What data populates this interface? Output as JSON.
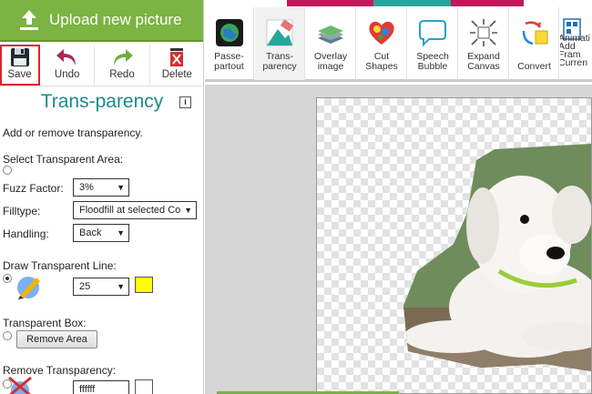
{
  "upload": {
    "label": "Upload new picture"
  },
  "toolbar": {
    "save": "Save",
    "undo": "Undo",
    "redo": "Redo",
    "delete": "Delete"
  },
  "panel": {
    "title": "Trans-parency",
    "info_icon": "i",
    "description": "Add or remove transparency.",
    "select_area_label": "Select Transparent Area:",
    "fuzz_label": "Fuzz Factor:",
    "fuzz_value": "3%",
    "filltype_label": "Filltype:",
    "filltype_value": "Floodfill at selected Co",
    "handling_label": "Handling:",
    "handling_value": "Back",
    "draw_line_label": "Draw Transparent Line:",
    "line_width_value": "25",
    "line_color": "#ffff00",
    "box_label": "Transparent Box:",
    "remove_area_button": "Remove Area",
    "remove_label": "Remove Transparency:",
    "remove_color_value": "ffffff"
  },
  "tools": [
    {
      "id": "passe-partout",
      "line1": "Passe-",
      "line2": "partout"
    },
    {
      "id": "transparency",
      "line1": "Trans-",
      "line2": "parency"
    },
    {
      "id": "overlay-image",
      "line1": "Overlay",
      "line2": "image"
    },
    {
      "id": "cut-shapes",
      "line1": "Cut",
      "line2": "Shapes"
    },
    {
      "id": "speech-bubble",
      "line1": "Speech",
      "line2": "Bubble"
    },
    {
      "id": "expand-canvas",
      "line1": "Expand",
      "line2": "Canvas"
    },
    {
      "id": "convert",
      "line1": "",
      "line2": "Convert"
    },
    {
      "id": "animation",
      "line1": "Animati",
      "line2": "Add",
      "line3": "Fram",
      "line4": "Curren"
    }
  ],
  "colors": {
    "accent_green": "#7cb342",
    "title_teal": "#1b8a8a",
    "save_highlight": "#d9262b",
    "stripe_magenta": "#c2185b",
    "stripe_teal": "#26a69a"
  }
}
